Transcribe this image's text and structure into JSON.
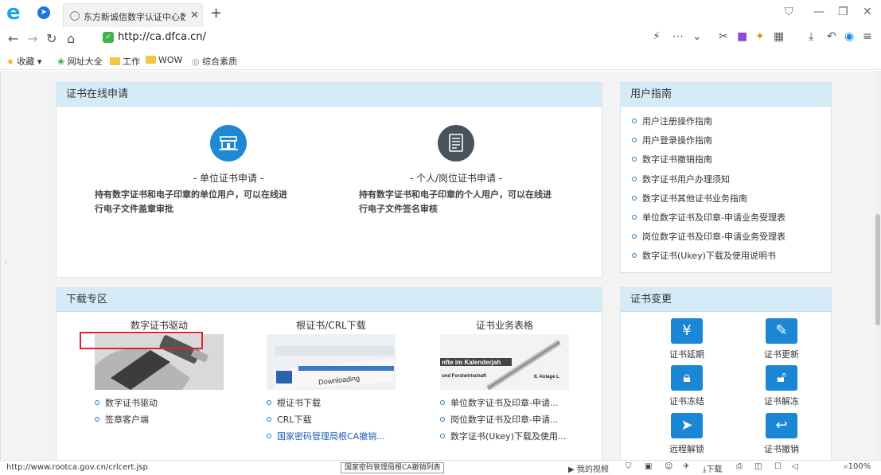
{
  "browser": {
    "tab_title": "东方新诚信数字认证中心数字",
    "url": "http://ca.dfca.cn/",
    "bookmarks": [
      "收藏",
      "网址大全",
      "工作",
      "WOW",
      "综合素质"
    ]
  },
  "apply": {
    "header": "证书在线申请",
    "org_title": "- 单位证书申请 -",
    "org_desc": [
      "持有数字证书和电子印章的单位用户，可以在线进",
      "行电子文件盖章审批"
    ],
    "personal_title": "- 个人/岗位证书申请 -",
    "personal_desc": [
      "持有数字证书和电子印章的个人用户，可以在线进",
      "行电子文件签名审核"
    ]
  },
  "guide": {
    "header": "用户指南",
    "items": [
      "用户注册操作指南",
      "用户登录操作指南",
      "数字证书撤销指南",
      "数字证书用户办理须知",
      "数字证书其他证书业务指南",
      "单位数字证书及印章-申请业务受理表",
      "岗位数字证书及印章-申请业务受理表",
      "数字证书(Ukey)下载及使用说明书"
    ]
  },
  "download": {
    "header": "下载专区",
    "columns": [
      {
        "title": "数字证书驱动",
        "links": [
          "数字证书驱动",
          "签章客户端"
        ]
      },
      {
        "title": "根证书/CRL下载",
        "links": [
          "根证书下载",
          "CRL下载",
          "国家密码管理局根CA撤销..."
        ]
      },
      {
        "title": "证书业务表格",
        "links": [
          "单位数字证书及印章-申请...",
          "岗位数字证书及印章-申请...",
          "数字证书(Ukey)下载及使用..."
        ]
      }
    ],
    "img_text_downloading": "Downloading",
    "img_text_kalender": "nfte im Kalenderjah",
    "img_text_forst": "und Forstwirtschaft",
    "img_text_anlage": "II. Anlage L"
  },
  "change": {
    "header": "证书变更",
    "items": [
      "证书延期",
      "证书更新",
      "证书冻结",
      "证书解冻",
      "远程解锁",
      "证书撤销"
    ]
  },
  "status": {
    "url": "http://www.rootca.gov.cn/crlcert.jsp",
    "tooltip": "国家密码管理局根CA撤销列表",
    "video": "我的视频",
    "download": "下载",
    "zoom": "100%"
  }
}
